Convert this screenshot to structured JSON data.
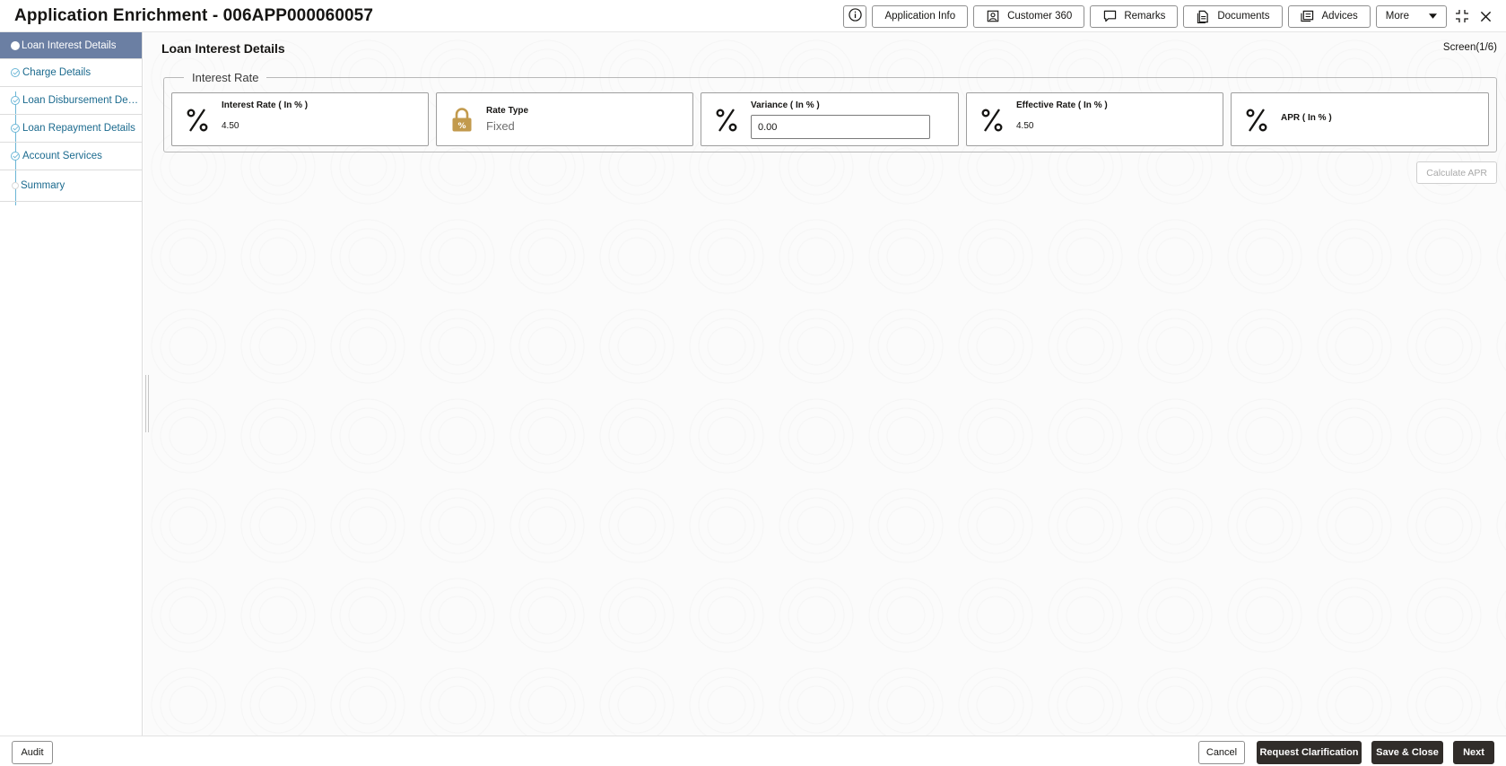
{
  "header": {
    "title": "Application Enrichment - 006APP000060057",
    "buttons": {
      "application_info": "Application Info",
      "customer_360": "Customer 360",
      "remarks": "Remarks",
      "documents": "Documents",
      "advices": "Advices",
      "more": "More"
    }
  },
  "sidebar": {
    "items": [
      {
        "label": "Loan Interest Details",
        "state": "active"
      },
      {
        "label": "Charge Details",
        "state": "done"
      },
      {
        "label": "Loan Disbursement Details",
        "state": "done"
      },
      {
        "label": "Loan Repayment Details",
        "state": "done"
      },
      {
        "label": "Account Services",
        "state": "done"
      },
      {
        "label": "Summary",
        "state": "pending"
      }
    ]
  },
  "main": {
    "section_title": "Loan Interest Details",
    "screen_count": "Screen(1/6)",
    "interest_rate_group": {
      "legend": "Interest Rate",
      "tiles": {
        "interest_rate": {
          "label": "Interest Rate ( In % )",
          "value": "4.50"
        },
        "rate_type": {
          "label": "Rate Type",
          "value": "Fixed"
        },
        "variance": {
          "label": "Variance ( In % )",
          "value": "0.00"
        },
        "effective_rate": {
          "label": "Effective Rate ( In % )",
          "value": "4.50"
        },
        "apr": {
          "label": "APR ( In % )"
        }
      }
    },
    "calculate_apr": "Calculate APR"
  },
  "footer": {
    "audit": "Audit",
    "cancel": "Cancel",
    "request_clarification": "Request Clarification",
    "save_close": "Save & Close",
    "next": "Next"
  },
  "colors": {
    "accent_blue": "#1b6a8e",
    "sidebar_active": "#6b7fa3",
    "dark_button": "#312d2a",
    "lock_icon": "#c29a4d"
  }
}
